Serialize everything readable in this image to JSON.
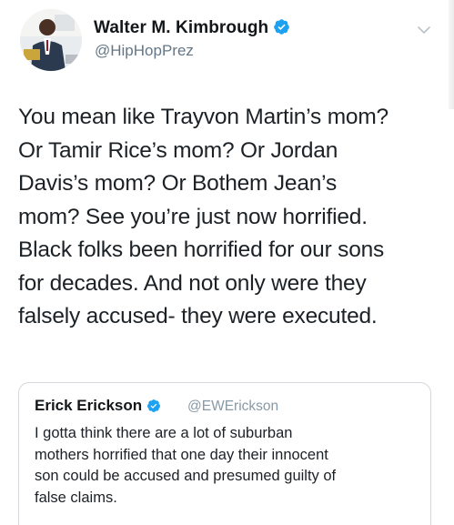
{
  "tweet": {
    "author": {
      "name": "Walter M. Kimbrough",
      "handle": "@HipHopPrez",
      "verified": true
    },
    "text": "You mean like Trayvon Martin’s mom?\nOr Tamir Rice’s mom? Or Jordan\nDavis’s mom? Or Bothem Jean’s\nmom? See you’re just now horrified.\nBlack folks been horrified for our sons\nfor decades. And not only were they\nfalsely accused- they were executed."
  },
  "quoted_tweet": {
    "author": {
      "name": "Erick Erickson",
      "handle": "@EWErickson",
      "verified": true
    },
    "text": "I gotta think there are a lot of suburban\nmothers horrified that one day their innocent\nson could be accused and presumed guilty of\nfalse claims."
  },
  "colors": {
    "verified_badge": "#1da1f2",
    "handle_text": "#657786",
    "border": "#d4d8dc"
  },
  "icons": {
    "verified": "verified-badge-icon",
    "menu": "chevron-down-icon"
  }
}
